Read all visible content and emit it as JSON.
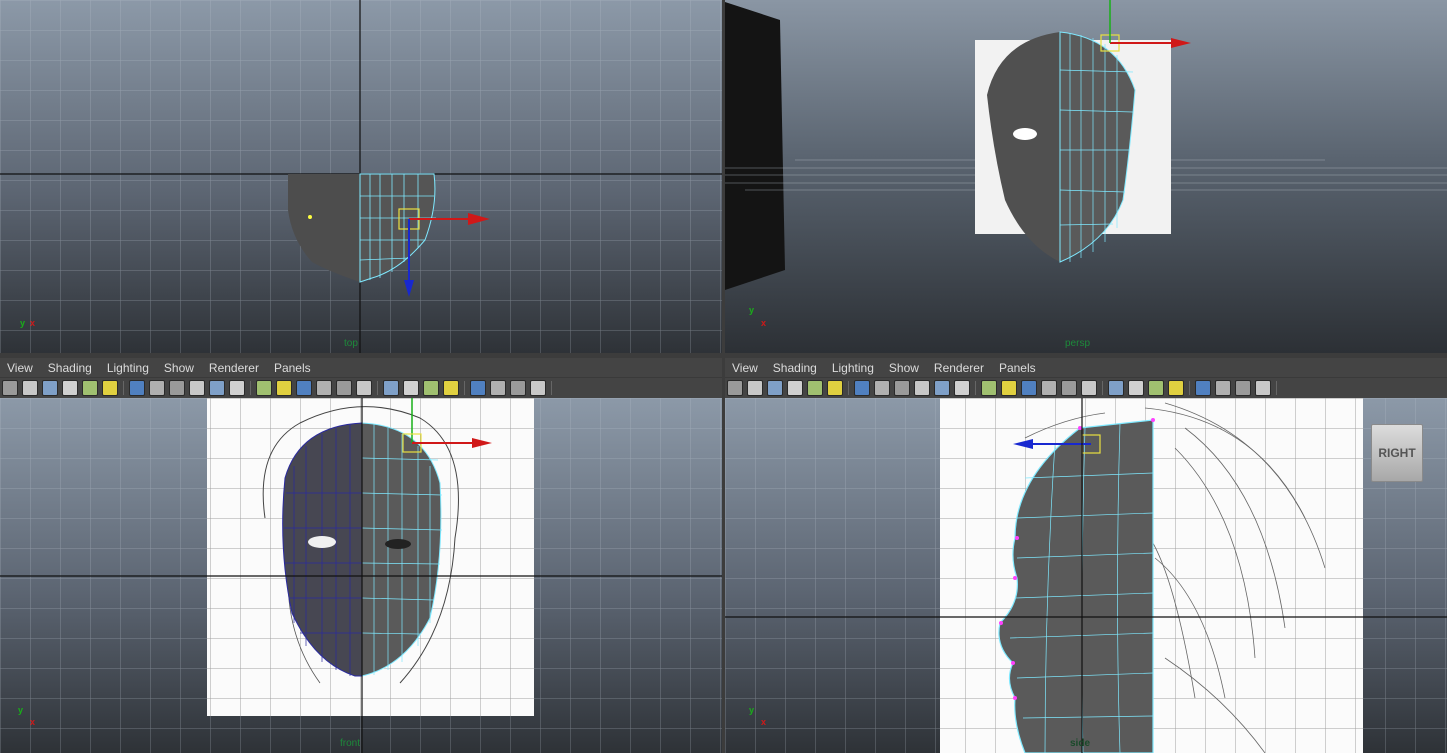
{
  "panels": {
    "top_left": {
      "camera_label": "top"
    },
    "top_right": {
      "camera_label": "persp"
    },
    "bottom_left": {
      "camera_label": "front"
    },
    "bottom_right": {
      "camera_label": "side"
    }
  },
  "menu": {
    "left": [
      "View",
      "Shading",
      "Lighting",
      "Show",
      "Renderer",
      "Panels"
    ],
    "right": [
      "View",
      "Shading",
      "Lighting",
      "Show",
      "Renderer",
      "Panels"
    ]
  },
  "viewcube": {
    "label": "RIGHT"
  },
  "axis": {
    "x": "x",
    "y": "y"
  },
  "colors": {
    "wire": "#7fe9ff",
    "vertex": "#ff40ff",
    "move_x": "#d01818",
    "move_y": "#18b018",
    "move_z": "#1828d0",
    "label": "#1d8a3a"
  },
  "icons": [
    "select-camera",
    "lock-camera",
    "bookmarks",
    "image-plane",
    "2d-pan",
    "grease-pencil",
    "wireframe",
    "smooth-shade",
    "flat-shade",
    "bounding-box",
    "points",
    "textured",
    "lighting-default",
    "lighting-all",
    "shadows",
    "ambient-occlusion",
    "motion-blur",
    "anti-alias",
    "depth-of-field",
    "isolate-select",
    "xray",
    "xray-joints",
    "xray-components",
    "frame-selection",
    "frame-all",
    "resolution-gate"
  ]
}
